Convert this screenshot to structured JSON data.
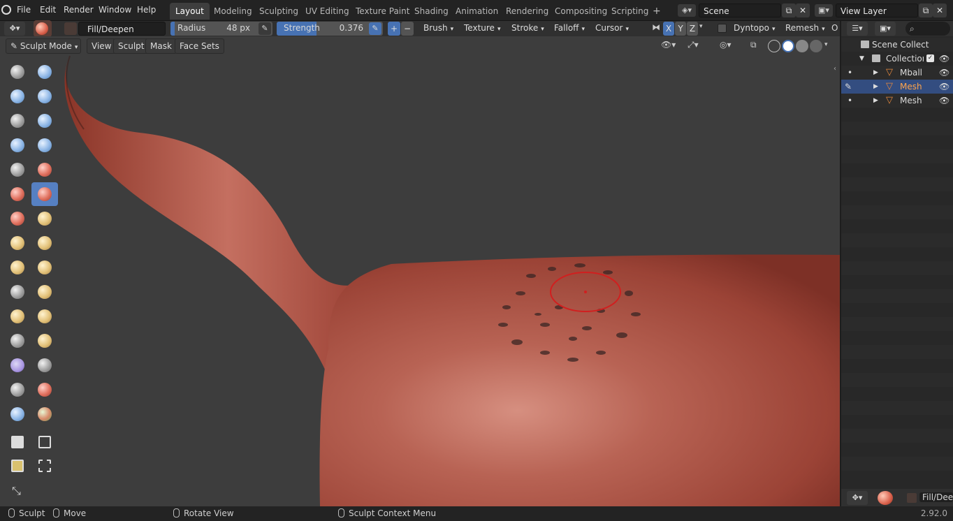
{
  "menubar": {
    "items": [
      "File",
      "Edit",
      "Render",
      "Window",
      "Help"
    ],
    "workspaces": [
      "Layout",
      "Modeling",
      "Sculpting",
      "UV Editing",
      "Texture Paint",
      "Shading",
      "Animation",
      "Rendering",
      "Compositing",
      "Scripting"
    ],
    "active_workspace": "Layout",
    "add_tab": "+",
    "scene": "Scene",
    "view_layer": "View Layer"
  },
  "toolheader": {
    "brush_name": "Fill/Deepen",
    "radius_label": "Radius",
    "radius_value": "48 px",
    "strength_label": "Strength",
    "strength_value": "0.376",
    "strength_fraction": 0.376,
    "plus": "+",
    "minus": "−",
    "dropdowns": [
      "Brush",
      "Texture",
      "Stroke",
      "Falloff",
      "Cursor"
    ],
    "axes": [
      "X",
      "Y",
      "Z"
    ],
    "dyntopo": "Dyntopo",
    "remesh": "Remesh",
    "overflow": "O"
  },
  "modeheader": {
    "mode": "Sculpt Mode",
    "menus": [
      "View",
      "Sculpt",
      "Mask",
      "Face Sets"
    ]
  },
  "outliner": {
    "rows": [
      {
        "label": "Scene Collect",
        "type": "scene-collection"
      },
      {
        "label": "Collection",
        "type": "collection"
      },
      {
        "label": "Mball",
        "type": "mesh"
      },
      {
        "label": "Mesh",
        "type": "mesh",
        "selected": true
      },
      {
        "label": "Mesh",
        "type": "mesh"
      }
    ],
    "footer_brush": "Fill/Deep"
  },
  "statusbar": {
    "left": "Sculpt",
    "middle": "Move",
    "rotate": "Rotate View",
    "context": "Sculpt Context Menu",
    "version": "2.92.0"
  },
  "colors": {
    "accent": "#5680c2",
    "selected_row": "#334d80",
    "mesh_icon": "#e6883d",
    "active_text": "#ffa44a"
  }
}
